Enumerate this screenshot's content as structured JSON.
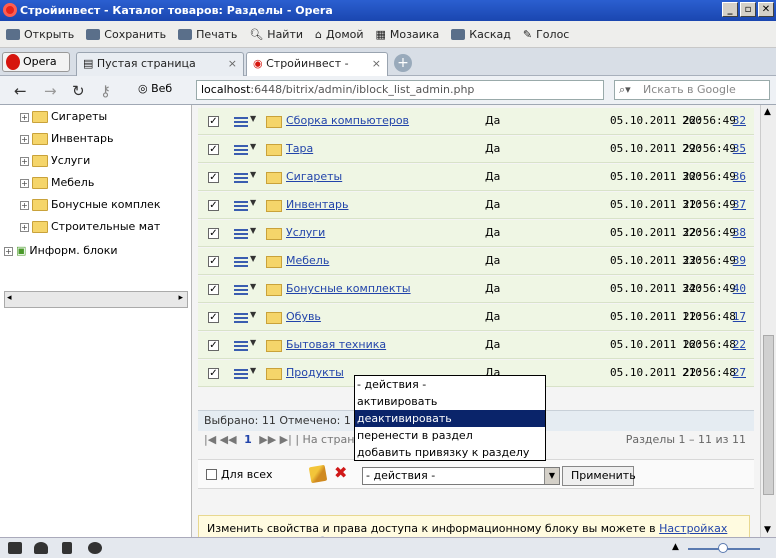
{
  "window": {
    "title": "Стройинвест - Каталог товаров: Разделы - Opera"
  },
  "toolbar": {
    "items": [
      "Открыть",
      "Сохранить",
      "Печать",
      "Найти",
      "Домой",
      "Мозаика",
      "Каскад",
      "Голос"
    ]
  },
  "tabs": [
    {
      "label": "Пустая страница"
    },
    {
      "label": "Стройинвест - Каталог..."
    }
  ],
  "opera_button": "Opera",
  "address": {
    "web_label": "Веб",
    "host": "localhost",
    "path": ":6448/bitrix/admin/iblock_list_admin.php",
    "search_placeholder": "Искать в Google"
  },
  "sidebar": {
    "items": [
      "Сигареты",
      "Инвентарь",
      "Услуги",
      "Мебель",
      "Бонусные комплек",
      "Строительные мат"
    ],
    "root_item": "Информ. блоки"
  },
  "table": {
    "rows": [
      {
        "name": "Сборка компьютеров",
        "active": "Да",
        "sort": "260",
        "date": "05.10.2011 22:56:49",
        "id": "32"
      },
      {
        "name": "Тара",
        "active": "Да",
        "sort": "290",
        "date": "05.10.2011 22:56:49",
        "id": "35"
      },
      {
        "name": "Сигареты",
        "active": "Да",
        "sort": "300",
        "date": "05.10.2011 22:56:49",
        "id": "36"
      },
      {
        "name": "Инвентарь",
        "active": "Да",
        "sort": "310",
        "date": "05.10.2011 22:56:49",
        "id": "37"
      },
      {
        "name": "Услуги",
        "active": "Да",
        "sort": "320",
        "date": "05.10.2011 22:56:49",
        "id": "38"
      },
      {
        "name": "Мебель",
        "active": "Да",
        "sort": "330",
        "date": "05.10.2011 22:56:49",
        "id": "39"
      },
      {
        "name": "Бонусные комплекты",
        "active": "Да",
        "sort": "340",
        "date": "05.10.2011 22:56:49",
        "id": "40"
      },
      {
        "name": "Обувь",
        "active": "Да",
        "sort": "110",
        "date": "05.10.2011 22:56:48",
        "id": "17"
      },
      {
        "name": "Бытовая техника",
        "active": "Да",
        "sort": "160",
        "date": "05.10.2011 22:56:48",
        "id": "22"
      },
      {
        "name": "Продукты",
        "active": "Да",
        "sort": "210",
        "date": "05.10.2011 22:56:48",
        "id": "27"
      }
    ]
  },
  "stats": {
    "text": "Выбрано: 11  Отмечено: 1"
  },
  "pager": {
    "nav_first": "|◀ ◀◀",
    "current": "1",
    "nav_last": "▶▶ ▶|",
    "label": "| На страни",
    "count": "Разделы 1 – 11 из 11"
  },
  "actions": {
    "for_all": "Для всех",
    "selected": "- действия -",
    "apply": "Применить",
    "options": [
      "- действия -",
      "активировать",
      "деактивировать",
      "перенести в раздел",
      "добавить привязку к разделу"
    ]
  },
  "info": {
    "text": "Изменить свойства и права доступа к информационному блоку вы можете в ",
    "link": "Настройках информационного блока."
  }
}
